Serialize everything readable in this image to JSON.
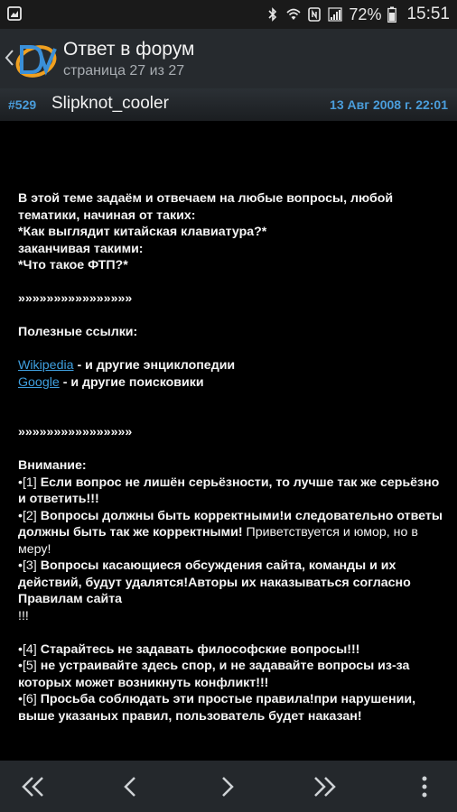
{
  "status_bar": {
    "battery_percent": "72%",
    "time": "15:51",
    "icons": [
      "gallery-notification-icon",
      "bluetooth-icon",
      "wifi-icon",
      "nfc-icon",
      "signal-icon",
      "battery-icon"
    ]
  },
  "app_bar": {
    "title": "Ответ в форум",
    "subtitle": "страница 27 из 27",
    "logo": "4pda-logo"
  },
  "post": {
    "number": "#529",
    "author": "Slipknot_cooler",
    "date": "13 Авг 2008 г. 22:01",
    "lines": {
      "l1": "В этой теме задаём и отвечаем на любые вопросы, любой тематики, начиная от таких:",
      "l2": "*Как выглядит китайская клавиатура?*",
      "l3": "заканчивая такими:",
      "l4": "*Что такое ФТП?*",
      "sep1": "»»»»»»»»»»»»»»»»",
      "useful_heading": "Полезные ссылки:",
      "link1_text": "Wikipedia",
      "link1_suffix": " - и другие энциклопедии",
      "link2_text": "Google",
      "link2_suffix": " - и другие поисковики",
      "sep2": "»»»»»»»»»»»»»»»»",
      "attention": "Внимание:",
      "r1_prefix": "•[1]",
      "r1": " Если вопрос не лишён серьёзности, то лучше так же серьёзно и ответить!!!",
      "r2_prefix": "•[2]",
      "r2_bold": " Вопросы должны быть корректными!и следовательно ответы должны быть так же корректными!",
      "r2_normal": " Приветствуется и юмор, но в меру!",
      "r3_prefix": "•[3]",
      "r3": " Вопросы касающиеся обсуждения сайта, команды и их действий, будут удалятся!Авторы их наказываться согласно Правилам сайта",
      "r3_tail": "!!!",
      "r4_prefix": "•[4]",
      "r4": " Старайтесь не задавать философские вопросы!!!",
      "r5_prefix": "•[5]",
      "r5": " не устраивайте здесь спор, и не задавайте вопросы из-за которых может возникнуть конфликт!!!",
      "r6_prefix": "•[6]",
      "r6": " Просьба соблюдать эти простые правила!при нарушении, выше указаных правил, пользователь будет наказан!"
    }
  },
  "bottom_nav": [
    "first-page",
    "previous-page",
    "next-page",
    "last-page",
    "more-options"
  ],
  "colors": {
    "accent": "#4a9ddb",
    "app_bar": "#262a2e",
    "background": "#000000"
  }
}
